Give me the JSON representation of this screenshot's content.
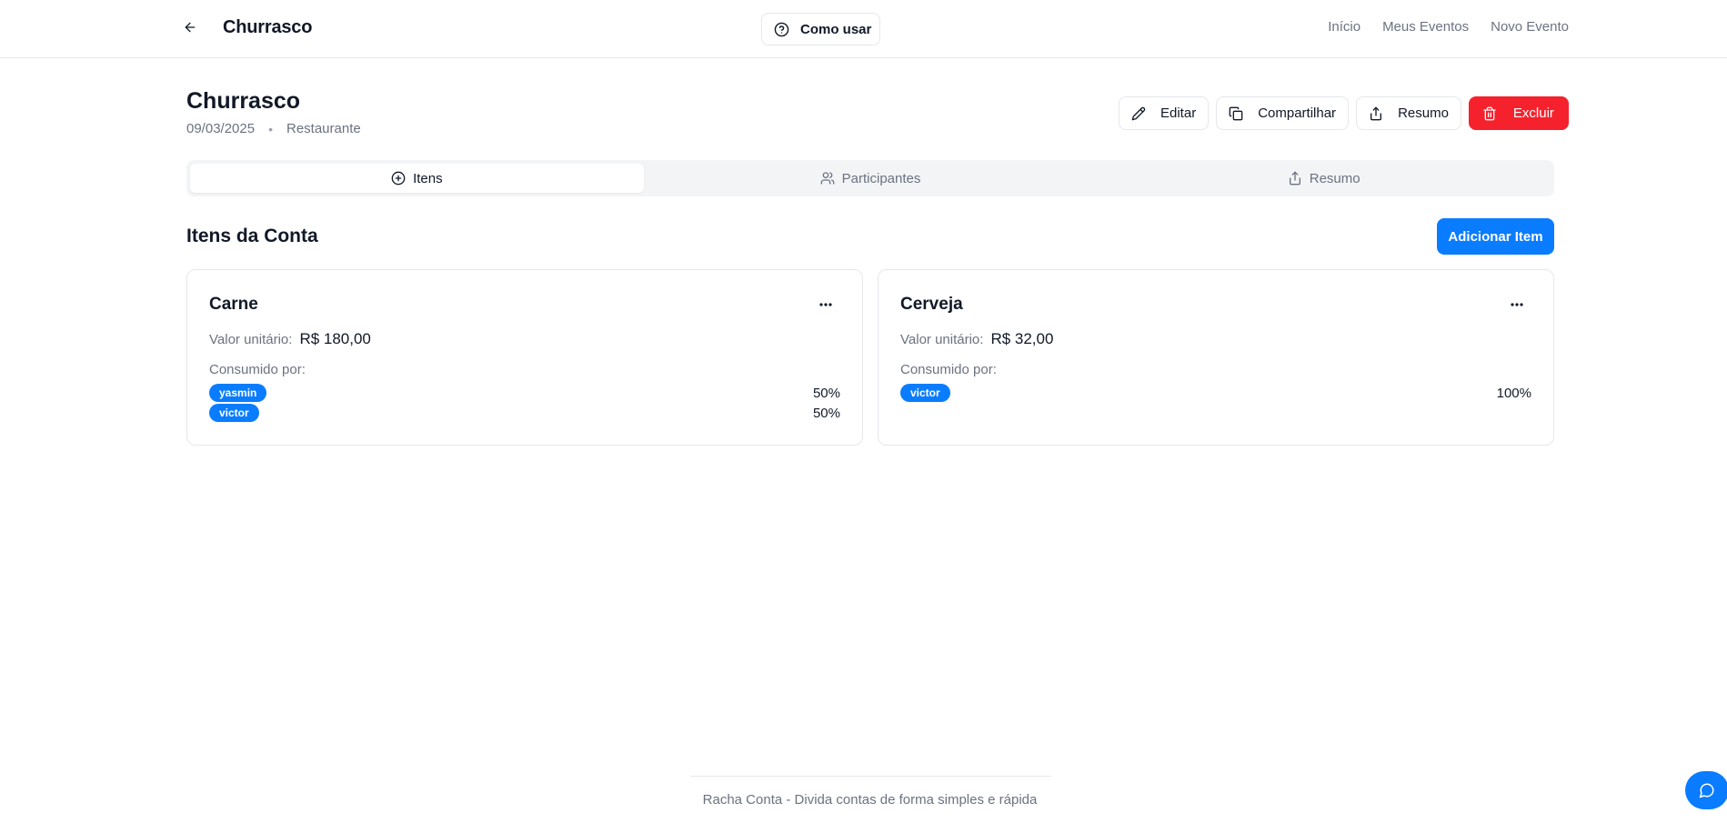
{
  "colors": {
    "primary": "#0a7cff",
    "danger": "#f5222d",
    "muted_text": "#6b7280",
    "border": "#e5e7eb",
    "tabs_bg": "#f3f4f6"
  },
  "topbar": {
    "back_icon": "arrow-left-icon",
    "title": "Churrasco",
    "help_button": {
      "label": "Como usar",
      "icon": "help-circle-icon"
    },
    "links": [
      "Início",
      "Meus Eventos",
      "Novo Evento"
    ]
  },
  "event": {
    "title": "Churrasco",
    "date": "09/03/2025",
    "separator": "•",
    "place": "Restaurante"
  },
  "actions": {
    "edit": {
      "label": "Editar",
      "icon": "pencil-icon"
    },
    "share": {
      "label": "Compartilhar",
      "icon": "copy-icon"
    },
    "summary": {
      "label": "Resumo",
      "icon": "share-icon"
    },
    "delete": {
      "label": "Excluir",
      "icon": "trash-icon"
    }
  },
  "tabs": [
    {
      "label": "Itens",
      "icon": "plus-circle-icon",
      "active": true
    },
    {
      "label": "Participantes",
      "icon": "users-icon",
      "active": false
    },
    {
      "label": "Resumo",
      "icon": "share-icon",
      "active": false
    }
  ],
  "section": {
    "title": "Itens da Conta",
    "add_button": "Adicionar Item"
  },
  "items": [
    {
      "name": "Carne",
      "price_label": "Valor unitário:",
      "price": "R$ 180,00",
      "consumed_label": "Consumido por:",
      "consumers": [
        {
          "name": "yasmin",
          "percent": "50%"
        },
        {
          "name": "victor",
          "percent": "50%"
        }
      ]
    },
    {
      "name": "Cerveja",
      "price_label": "Valor unitário:",
      "price": "R$ 32,00",
      "consumed_label": "Consumido por:",
      "consumers": [
        {
          "name": "victor",
          "percent": "100%"
        }
      ]
    }
  ],
  "footer": {
    "text": "Racha Conta - Divida contas de forma simples e rápida"
  },
  "chat_button": {
    "icon": "chat-bubble-icon"
  }
}
